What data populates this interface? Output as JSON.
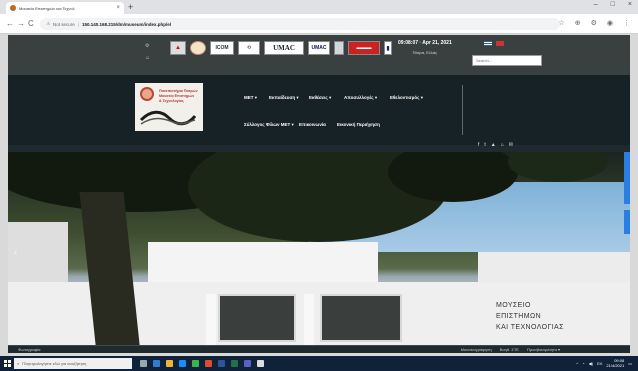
{
  "browser": {
    "tab_title": "Μουσείο Επιστημών και Τεχνολ",
    "tab_close": "×",
    "new_tab": "+",
    "window_controls": [
      "–",
      "□",
      "×"
    ],
    "nav": {
      "back": "←",
      "forward": "→",
      "reload": "C"
    },
    "security_label": "Not secure",
    "url": "150.140.168.215/dm/museum/index.php/el",
    "tools": [
      "☆",
      "⊕",
      "⚙",
      "◉",
      "⋮"
    ]
  },
  "topbar": {
    "partner_logos": [
      "▲",
      "",
      "ICOM",
      "UMAC",
      "⟲",
      "UMAC",
      "",
      "▬▬▬",
      "▮"
    ],
    "datetime": "09:08:07 · Apr 21, 2021",
    "location": "Πάτρα, Ελλάς",
    "languages": [
      "el",
      "en"
    ],
    "search_placeholder": "Search..."
  },
  "header": {
    "logo_text": [
      "Πανεπιστήμιο Πατρών",
      "Μουσείο Επιστημών",
      "& Τεχνολογίας"
    ],
    "menu_row1": [
      "ΜΕΤ ▾",
      "Εκπαίδευση ▾",
      "Εκθέσεις ▾",
      "Αποσυλλογές ▾",
      "Εθελοντισμός ▾"
    ],
    "menu_row2": [
      "Σύλλογος Φίλων ΜΕΤ ▾",
      "Επικοινωνία",
      "Εικονική Περιήγηση"
    ],
    "socials": [
      "f",
      "t",
      "▲",
      "⌂",
      "✉"
    ]
  },
  "hero": {
    "sign_lines": [
      "ΜΟΥΣΕΙΟ",
      "ΕΠΙΣΤΗΜΩΝ",
      "ΚΑΙ ΤΕΧΝΟΛΟΓΙΑΣ"
    ],
    "prev_arrow": "‹"
  },
  "statusbar": {
    "left": "Φωτογραφία",
    "right": [
      "Μουσειογράφηση",
      "Βοηθ. ΣΤΕ",
      "Προσβασιμότητα ▾"
    ]
  },
  "taskbar": {
    "search_placeholder": "Πληκτρολογήστε εδώ για αναζήτηση",
    "time": "09:08",
    "date": "21/4/2021",
    "lang": "ΕΛ"
  },
  "colors": {
    "site_bg": "#1e2a2e",
    "topbar_bg": "#3a3f40",
    "taskbar_bg": "#10213a",
    "accent_blue": "#2a7de1"
  }
}
